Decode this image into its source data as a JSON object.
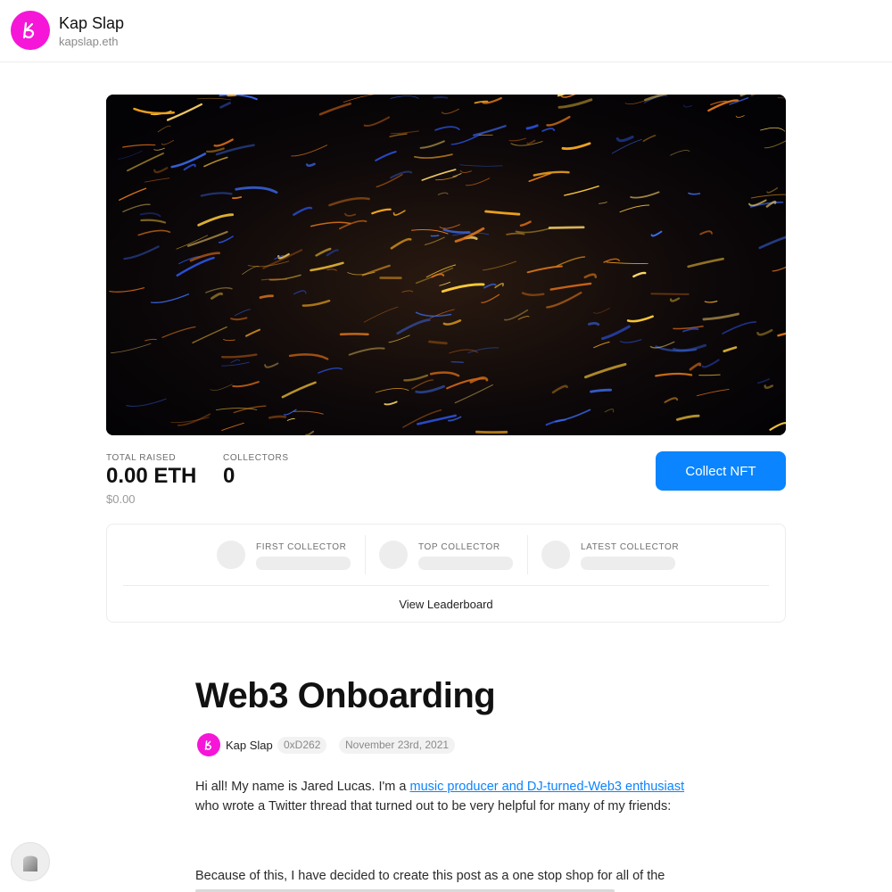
{
  "header": {
    "site_name": "Kap Slap",
    "site_handle": "kapslap.eth",
    "logo_icon": "kapslap-logo-icon",
    "logo_color": "#f516d8"
  },
  "hero": {
    "image": "abstract-light-streaks",
    "colors": [
      "#050308",
      "#f2a51f",
      "#2a4fd6"
    ]
  },
  "stats": {
    "total_raised_label": "TOTAL RAISED",
    "total_raised_value": "0.00 ETH",
    "total_raised_usd": "$0.00",
    "collectors_label": "COLLECTORS",
    "collectors_value": "0"
  },
  "collect_button": {
    "label": "Collect NFT",
    "color": "#0a84ff"
  },
  "collectors": {
    "slots": [
      {
        "label": "FIRST COLLECTOR"
      },
      {
        "label": "TOP COLLECTOR"
      },
      {
        "label": "LATEST COLLECTOR"
      }
    ],
    "leaderboard_label": "View Leaderboard"
  },
  "post": {
    "title": "Web3 Onboarding",
    "author": "Kap Slap",
    "address": "0xD262",
    "date": "November 23rd, 2021",
    "intro_before_link": "Hi all! My name is Jared Lucas. I'm a ",
    "intro_link": "music producer and DJ-turned-Web3 enthusiast",
    "intro_after_link": " who wrote a Twitter thread that turned out to be very helpful for many of my friends:",
    "second_paragraph": "Because of this, I have decided to create this post as a one stop shop for all of the"
  },
  "floating_button": {
    "icon": "mirror-icon"
  }
}
